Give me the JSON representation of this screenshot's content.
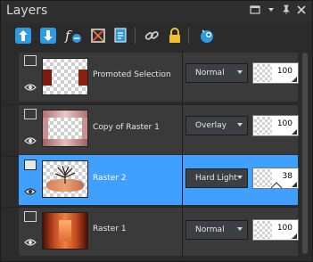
{
  "panel": {
    "title": "Layers",
    "controls": {
      "menu": "☐",
      "dropdown": "▾",
      "pin": "📌",
      "close": "✕"
    }
  },
  "toolbar": {
    "tools": [
      "new-raster-layer-icon",
      "new-mask-layer-icon",
      "fx-adjust-icon",
      "delete-layer-icon",
      "duplicate-layer-icon",
      "link-icon",
      "lock-icon",
      "view-icon"
    ]
  },
  "layers": [
    {
      "name": "Promoted Selection",
      "blend": "Normal",
      "opacity": "100",
      "selected": false
    },
    {
      "name": "Copy of Raster 1",
      "blend": "Overlay",
      "opacity": "100",
      "selected": false
    },
    {
      "name": "Raster 2",
      "blend": "Hard Light",
      "opacity": "38",
      "selected": true
    },
    {
      "name": "Raster 1",
      "blend": "Normal",
      "opacity": "100",
      "selected": false
    }
  ],
  "colors": {
    "selection": "#3fa0ff",
    "panel_bg": "#2b2b2b",
    "row_bg": "#3a3a3a"
  }
}
